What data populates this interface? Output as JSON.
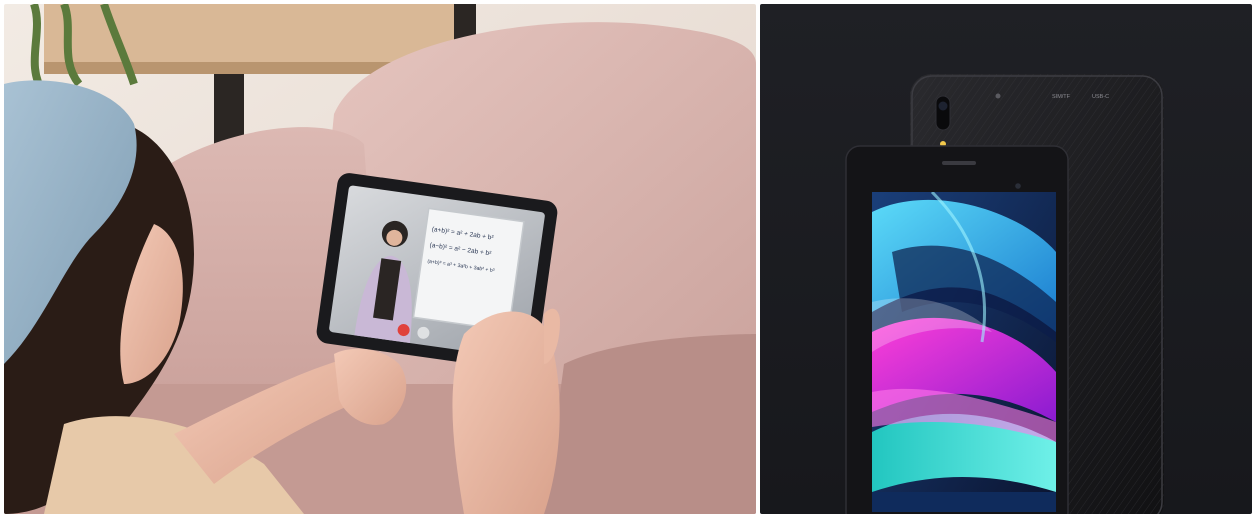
{
  "left_scene": {
    "board_lines": [
      "(a+b)² = a² + 2ab + b²",
      "(a−b)² = a² − 2ab + b²",
      "(a+b)³ = a³ + 3a²b + 3ab² + b³"
    ]
  },
  "right_scene": {
    "back_port_labels": [
      "SIM/TF",
      "USB-C"
    ]
  },
  "colors": {
    "sofa_pink": "#d9b3ad",
    "wall_warm": "#efe6de",
    "right_bg": "#1c1d22",
    "tablet_black": "#16161a"
  }
}
